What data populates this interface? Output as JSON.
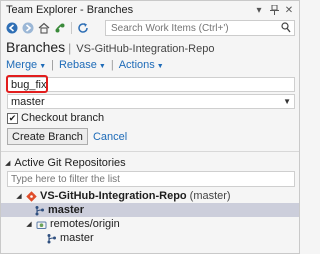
{
  "window": {
    "title": "Team Explorer - Branches",
    "pin_icon": "pin-icon",
    "close_icon": "close-icon"
  },
  "toolbar": {
    "back_icon": "back-arrow-icon",
    "forward_icon": "forward-arrow-icon",
    "home_icon": "home-icon",
    "plug_icon": "connect-icon",
    "refresh_icon": "refresh-icon",
    "search_placeholder": "Search Work Items (Ctrl+')",
    "search_icon": "search-icon"
  },
  "header": {
    "title": "Branches",
    "repo": "VS-GitHub-Integration-Repo"
  },
  "actions": {
    "merge": "Merge",
    "rebase": "Rebase",
    "actions": "Actions"
  },
  "form": {
    "branch_name": "bug_fix",
    "base_branch": "master",
    "checkout_label": "Checkout branch",
    "checkout_checked": true,
    "create_button": "Create Branch",
    "cancel_link": "Cancel"
  },
  "repos": {
    "section_title": "Active Git Repositories",
    "filter_placeholder": "Type here to filter the list",
    "repo_name": "VS-GitHub-Integration-Repo",
    "repo_branch_tag": "(master)",
    "local_branch": "master",
    "remote_folder": "remotes/origin",
    "remote_branch": "master"
  },
  "colors": {
    "accent": "#1e6bb8",
    "highlight_box": "#e21d1d",
    "selected_row": "#cccedb",
    "git_icon": "#e04e2c"
  }
}
